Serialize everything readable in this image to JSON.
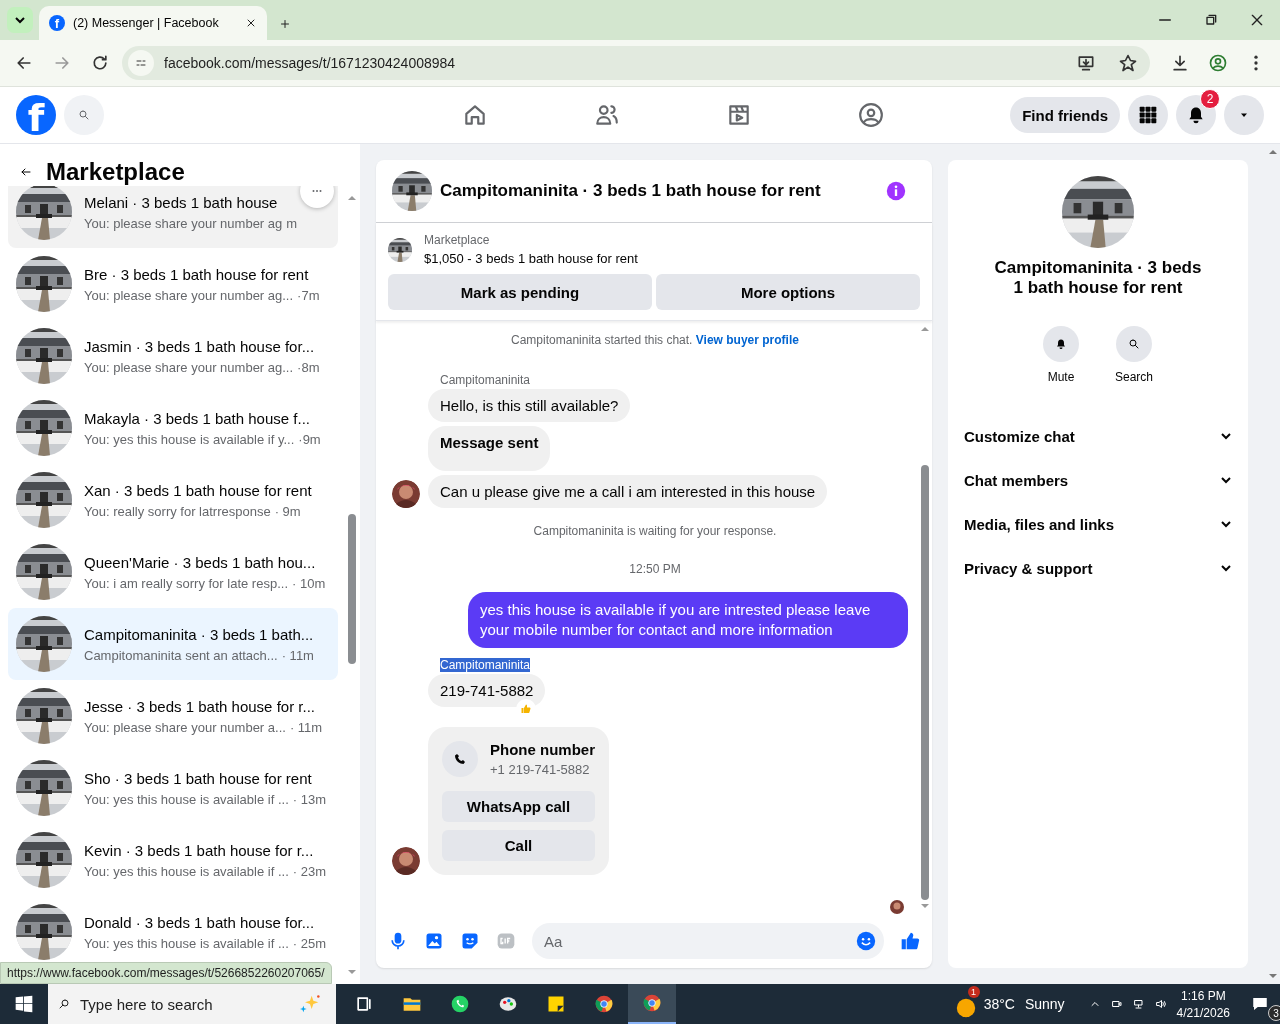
{
  "browser": {
    "favicon": "f",
    "tab_title": "(2) Messenger | Facebook",
    "url": "facebook.com/messages/t/1671230424008984",
    "status_url": "https://www.facebook.com/messages/t/5266852260207065/"
  },
  "header": {
    "logo": "f",
    "find_friends": "Find friends",
    "notification_count": "2"
  },
  "sidebar": {
    "title": "Marketplace",
    "conversations": [
      {
        "title": "Melani · 3 beds 1 bath house",
        "preview": "You: please share your number ag",
        "time": "m",
        "selected": false,
        "hovered": true
      },
      {
        "title": "Bre · 3 beds 1 bath house for rent",
        "preview": "You: please share your number ag...",
        "time": "·7m",
        "selected": false,
        "hovered": false
      },
      {
        "title": "Jasmin · 3 beds 1 bath house for...",
        "preview": "You: please share your number ag...",
        "time": "·8m",
        "selected": false,
        "hovered": false
      },
      {
        "title": "Makayla · 3 beds 1 bath house f...",
        "preview": "You: yes this house is available if y...",
        "time": "·9m",
        "selected": false,
        "hovered": false
      },
      {
        "title": "Xan · 3 beds 1 bath house for rent",
        "preview": "You: really sorry for latrresponse",
        "time": "· 9m",
        "selected": false,
        "hovered": false
      },
      {
        "title": "Queen'Marie · 3 beds 1 bath hou...",
        "preview": "You: i am really sorry for late resp...",
        "time": "· 10m",
        "selected": false,
        "hovered": false
      },
      {
        "title": "Campitomaninita · 3 beds 1 bath...",
        "preview": "Campitomaninita sent an attach...",
        "time": "· 11m",
        "selected": true,
        "hovered": false
      },
      {
        "title": "Jesse · 3 beds 1 bath house for r...",
        "preview": "You: please share your number a...",
        "time": "· 11m",
        "selected": false,
        "hovered": false
      },
      {
        "title": "Sho · 3 beds 1 bath house for rent",
        "preview": "You: yes this house is available if ...",
        "time": "· 13m",
        "selected": false,
        "hovered": false
      },
      {
        "title": "Kevin · 3 beds 1 bath house for r...",
        "preview": "You: yes this house is available if ...",
        "time": "· 23m",
        "selected": false,
        "hovered": false
      },
      {
        "title": "Donald · 3 beds 1 bath house for...",
        "preview": "You: yes this house is available if ...",
        "time": "· 25m",
        "selected": false,
        "hovered": false
      }
    ]
  },
  "chat": {
    "title": "Campitomaninita · 3 beds 1 bath house for rent",
    "listing_label": "Marketplace",
    "listing": "$1,050 - 3 beds 1 bath house for rent",
    "buttons": [
      "Mark as pending",
      "More options"
    ],
    "messages": [
      {
        "kind": "system",
        "text": "Campitomaninita started this chat.",
        "link": "View buyer profile"
      },
      {
        "kind": "sender",
        "text": "Campitomaninita",
        "highlighted": false
      },
      {
        "kind": "incoming",
        "text": "Hello, is this still available?",
        "avatar": false,
        "bold": false
      },
      {
        "kind": "incoming",
        "text": "Message sent",
        "avatar": false,
        "bold": true
      },
      {
        "kind": "incoming",
        "text": "Can u please give me a call i am interested in this house",
        "avatar": true,
        "bold": false
      },
      {
        "kind": "system",
        "text": "Campitomaninita is waiting for your response."
      },
      {
        "kind": "time",
        "text": "12:50 PM"
      },
      {
        "kind": "outgoing",
        "text": "yes this house is available if you are intrested please leave your mobile number for contact and more information"
      },
      {
        "kind": "sender",
        "text": "Campitomaninita",
        "highlighted": true
      },
      {
        "kind": "incoming",
        "text": "219-741-5882",
        "avatar": false,
        "bold": false,
        "reaction": true
      },
      {
        "kind": "card",
        "title": "Phone number",
        "subtitle": "+1 219-741-5882",
        "buttons": [
          "WhatsApp call",
          "Call"
        ],
        "avatar": true
      }
    ],
    "composer_placeholder": "Aa"
  },
  "details": {
    "title": "Campitomaninita · 3 beds 1 bath house for rent",
    "actions": [
      {
        "kind": "mute",
        "label": "Mute"
      },
      {
        "kind": "search",
        "label": "Search"
      }
    ],
    "sections": [
      {
        "label": "Customize chat",
        "expanded": false
      },
      {
        "label": "Chat members",
        "expanded": false
      },
      {
        "label": "Media, files and links",
        "expanded": false
      },
      {
        "label": "Privacy & support",
        "expanded": false
      }
    ]
  },
  "taskbar": {
    "search_placeholder": "Type here to search",
    "weather_badge": "1",
    "temperature": "38°C",
    "condition": "Sunny",
    "time": "1:16 PM",
    "date": "4/21/2026",
    "notification_count": "3"
  }
}
